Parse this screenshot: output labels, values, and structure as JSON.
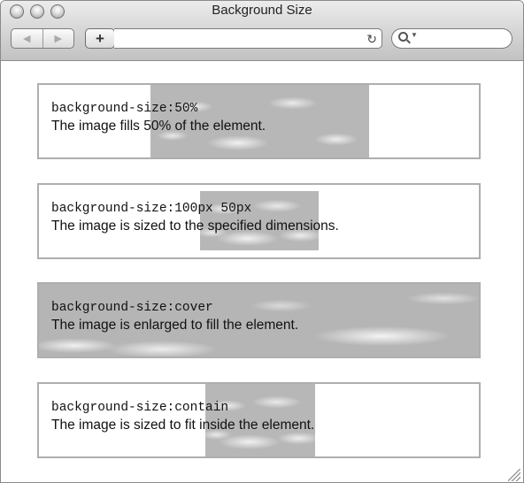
{
  "window": {
    "title": "Background Size"
  },
  "toolbar": {
    "back_icon": "back-arrow-icon",
    "forward_icon": "forward-arrow-icon",
    "add_label": "+",
    "url_value": "",
    "reload_icon": "reload-icon",
    "search_icon": "search-icon",
    "search_value": ""
  },
  "examples": [
    {
      "code": "background-size:50%",
      "description": "The image fills 50% of the element."
    },
    {
      "code": "background-size:100px 50px",
      "description": "The image is sized to the specified dimensions."
    },
    {
      "code": "background-size:cover",
      "description": "The image is enlarged to fill the element."
    },
    {
      "code": "background-size:contain",
      "description": "The image is sized to fit inside the element."
    }
  ],
  "colors": {
    "box_border": "#aeaeae",
    "sky": "#b7b7b7",
    "titlebar_top": "#ececec",
    "titlebar_bottom": "#c2c2c2"
  }
}
